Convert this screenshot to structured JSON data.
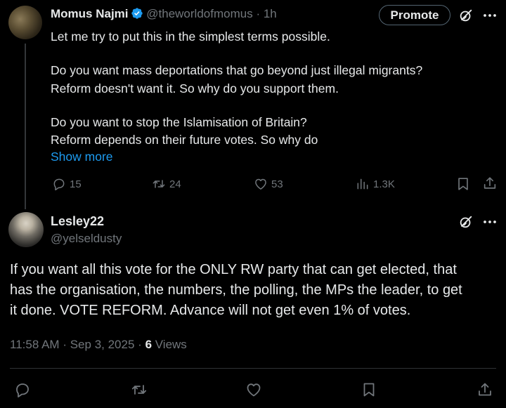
{
  "parent_tweet": {
    "author_name": "Momus Najmi",
    "handle": "@theworldofmomus",
    "separator": "·",
    "time": "1h",
    "promote_label": "Promote",
    "text_lines": [
      "Let me try to put this in the simplest terms possible.",
      "",
      "Do you want mass deportations that go beyond just illegal migrants?",
      "Reform doesn't want it. So why do you support them.",
      "",
      "Do you want to stop the Islamisation of Britain?",
      "Reform depends on their future votes. So why do"
    ],
    "show_more_label": "Show more",
    "actions": {
      "replies": "15",
      "reposts": "24",
      "likes": "53",
      "views": "1.3K"
    }
  },
  "focus_tweet": {
    "author_name": "Lesley22",
    "handle": "@yelseldusty",
    "text_lines": [
      "If you want all this vote for the ONLY RW party that can get elected, that",
      "has the organisation, the numbers, the polling, the MPs the leader, to get",
      "it done. VOTE REFORM. Advance will not get even 1% of votes."
    ],
    "time": "11:58 AM",
    "date": "Sep 3, 2025",
    "separator": "·",
    "views_count": "6",
    "views_label": "Views"
  },
  "icons": {
    "verified": "verified-badge-icon",
    "grok": "grok-icon",
    "more": "more-icon",
    "reply": "reply-icon",
    "repost": "repost-icon",
    "like": "like-icon",
    "views": "views-icon",
    "bookmark": "bookmark-icon",
    "share": "share-icon"
  },
  "colors": {
    "background": "#000000",
    "text_primary": "#e7e9ea",
    "text_muted": "#71767b",
    "accent": "#1d9bf0",
    "divider": "#2f3336"
  }
}
